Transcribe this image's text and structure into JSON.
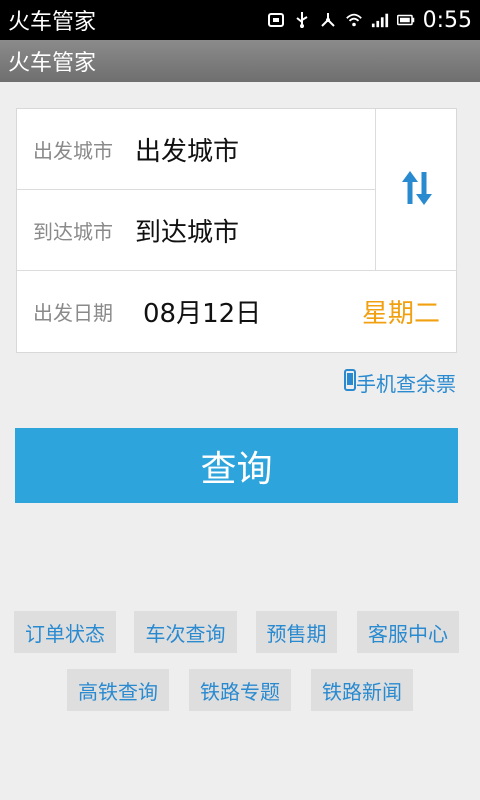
{
  "status_bar": {
    "app_name": "火车管家",
    "time": "0:55"
  },
  "title_bar": {
    "title": "火车管家"
  },
  "form": {
    "from_label": "出发城市",
    "from_value": "出发城市",
    "to_label": "到达城市",
    "to_value": "到达城市",
    "date_label": "出发日期",
    "date_value": "08月12日",
    "weekday": "星期二"
  },
  "phone_link": "手机查余票",
  "query_button": "查询",
  "quick_links": {
    "order_status": "订单状态",
    "train_query": "车次查询",
    "presale": "预售期",
    "service": "客服中心",
    "high_speed": "高铁查询",
    "railway_topic": "铁路专题",
    "railway_news": "铁路新闻"
  },
  "colors": {
    "accent": "#2da4db",
    "link": "#2a8ad0",
    "weekday": "#f0a010"
  }
}
